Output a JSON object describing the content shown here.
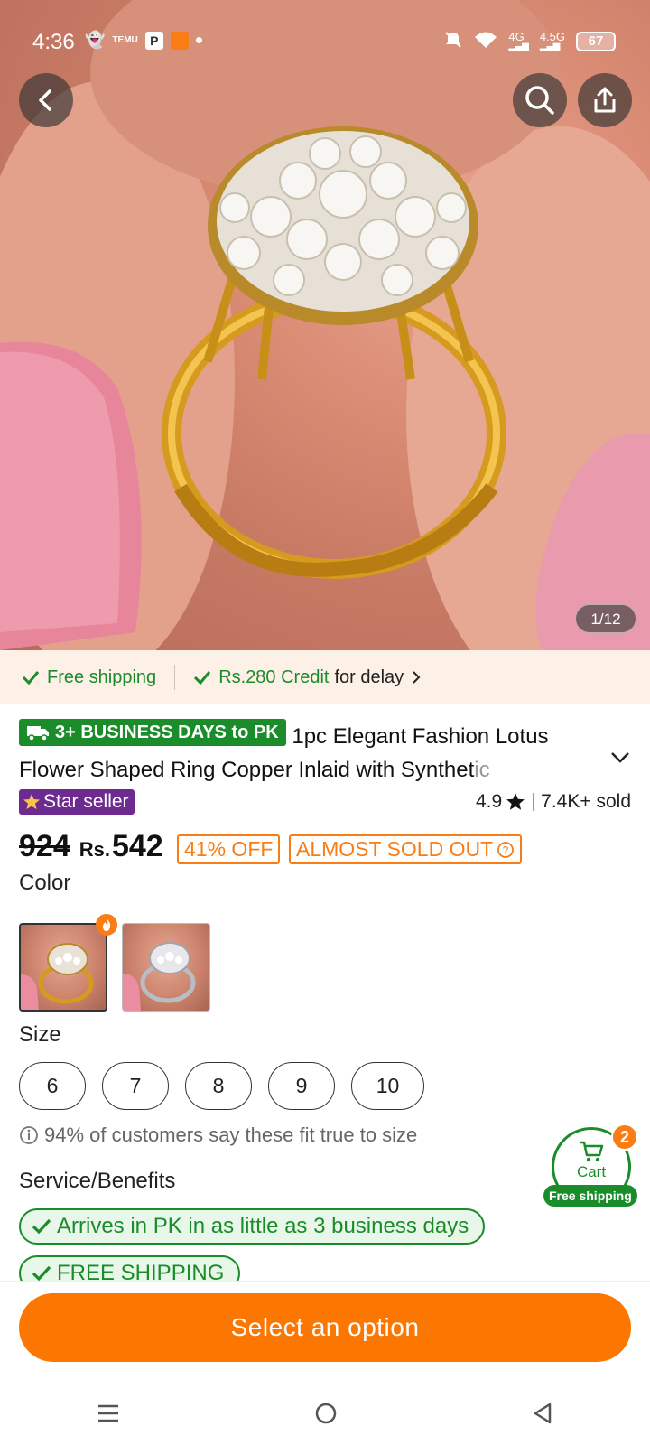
{
  "status_bar": {
    "time": "4:36",
    "battery": "67",
    "network_1": "4G",
    "network_2": "4.5G"
  },
  "gallery": {
    "counter": "1/12"
  },
  "shipping_bar": {
    "free_shipping": "Free shipping",
    "credit_amount": "Rs.280 Credit",
    "credit_suffix": "for delay"
  },
  "product": {
    "delivery_badge": "3+ BUSINESS DAYS to PK",
    "title_line1": "1pc Elegant Fashion Lotus",
    "title_line2": "Flower Shaped Ring Copper Inlaid with Synthet",
    "title_line2_fade": "ic",
    "star_seller": "Star seller",
    "rating": "4.9",
    "sold": "7.4K+ sold",
    "old_price": "924",
    "currency": "Rs.",
    "price": "542",
    "discount": "41% OFF",
    "stock_tag": "ALMOST SOLD OUT"
  },
  "color": {
    "label": "Color",
    "options": [
      "Gold",
      "Silver"
    ]
  },
  "size": {
    "label": "Size",
    "options": [
      "6",
      "7",
      "8",
      "9",
      "10"
    ]
  },
  "fit_note": "94% of customers say these fit true to size",
  "service": {
    "label": "Service/Benefits",
    "items": [
      "Arrives in PK in as little as 3 business days",
      "FREE SHIPPING"
    ]
  },
  "cart": {
    "label": "Cart",
    "count": "2",
    "badge": "Free shipping"
  },
  "cta": {
    "label": "Select an option"
  },
  "colors": {
    "accent_orange": "#fb7701",
    "green": "#1a8c2a",
    "star_purple": "#6d2b8f"
  }
}
